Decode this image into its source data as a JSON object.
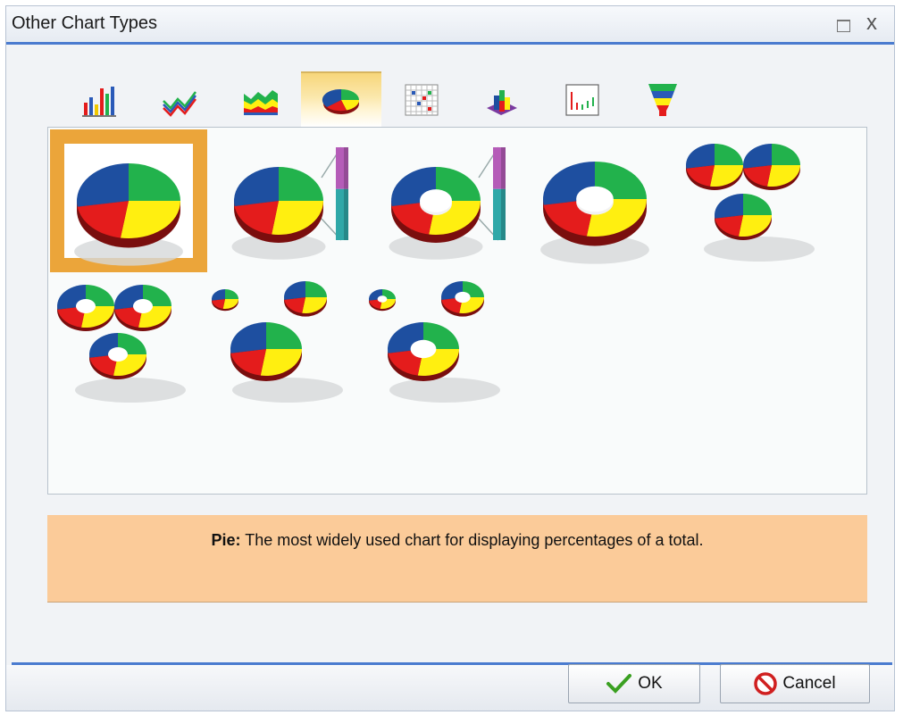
{
  "window": {
    "title": "Other Chart Types",
    "maximize_icon": "maximize-icon",
    "close_icon": "close-icon",
    "close_glyph": "x"
  },
  "tabs": [
    {
      "icon": "bar-chart-icon",
      "selected": false
    },
    {
      "icon": "line-chart-icon",
      "selected": false
    },
    {
      "icon": "area-chart-icon",
      "selected": false
    },
    {
      "icon": "pie-chart-icon",
      "selected": true
    },
    {
      "icon": "scatter-grid-icon",
      "selected": false
    },
    {
      "icon": "3d-bar-chart-icon",
      "selected": false
    },
    {
      "icon": "stock-chart-icon",
      "selected": false
    },
    {
      "icon": "funnel-chart-icon",
      "selected": false
    }
  ],
  "gallery": {
    "items": [
      {
        "variant": "pie",
        "selected": true
      },
      {
        "variant": "pie-bar",
        "selected": false
      },
      {
        "variant": "ring-pie-bar",
        "selected": false
      },
      {
        "variant": "ring-pie",
        "selected": false
      },
      {
        "variant": "multi-pie",
        "selected": false
      },
      {
        "variant": "multi-ring-pie",
        "selected": false
      },
      {
        "variant": "multi-proportional-pie",
        "selected": false
      },
      {
        "variant": "multi-proportional-ring-pie",
        "selected": false
      }
    ]
  },
  "description": {
    "term": "Pie:",
    "text": " The most widely used chart for displaying percentages of a total."
  },
  "buttons": {
    "ok_label": "OK",
    "cancel_label": "Cancel"
  },
  "colors": {
    "accent": "#4a7bcf",
    "selection": "#eba53a",
    "description_bg": "#fbcb99",
    "pie_blue": "#1e4fa0",
    "pie_green": "#22b24c",
    "pie_yellow": "#ffef10",
    "pie_red": "#e41c1c"
  }
}
